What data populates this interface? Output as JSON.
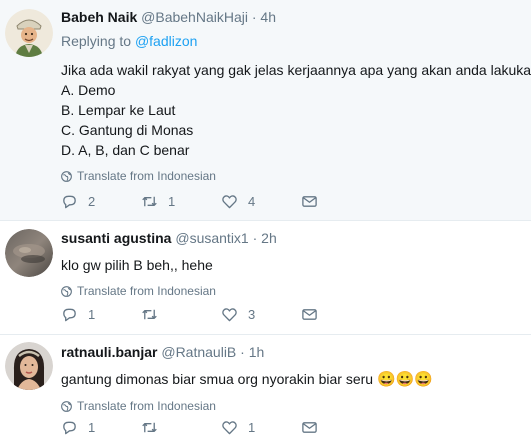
{
  "tweets": [
    {
      "name": "Babeh Naik",
      "handle": "@BabehNaikHaji",
      "separator": "·",
      "time": "4h",
      "replying_prefix": "Replying to",
      "replying_to": "@fadlizon",
      "lines": [
        "Jika ada wakil rakyat yang gak jelas kerjaannya apa yang akan anda lakukan?",
        "A. Demo",
        "B. Lempar ke Laut",
        "C. Gantung di Monas",
        "D. A, B, dan C benar"
      ],
      "translate": "Translate from Indonesian",
      "replies": "2",
      "retweets": "1",
      "likes": "4"
    },
    {
      "name": "susanti agustina",
      "handle": "@susantix1",
      "separator": "·",
      "time": "2h",
      "text": "klo gw pilih B beh,, hehe",
      "translate": "Translate from Indonesian",
      "replies": "1",
      "retweets": "",
      "likes": "3"
    },
    {
      "name": "ratnauli.banjar",
      "handle": "@RatnauliB",
      "separator": "·",
      "time": "1h",
      "text": "gantung dimonas biar smua org nyorakin biar seru",
      "emoji": "😀😀😀",
      "translate": "Translate from Indonesian",
      "replies": "1",
      "retweets": "",
      "likes": "1"
    }
  ],
  "colors": {
    "text": "#14171a",
    "secondary": "#657786",
    "link": "#1da1f2",
    "highlight_bg": "#f5f8fa",
    "thread_line": "#ccd6dd"
  },
  "icons": [
    "reply-icon",
    "retweet-icon",
    "like-icon",
    "direct-message-icon",
    "globe-icon"
  ]
}
